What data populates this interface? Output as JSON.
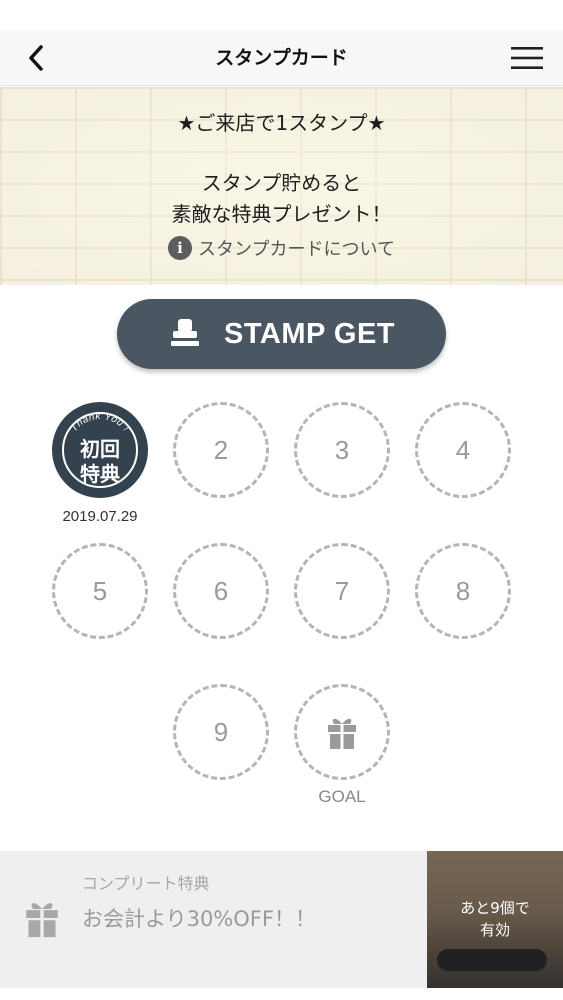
{
  "nav": {
    "title": "スタンプカード"
  },
  "banner": {
    "line1": "★ご来店で1スタンプ★",
    "line2": "スタンプ貯めると",
    "line3": "素敵な特典プレゼント！",
    "info_link": "スタンプカードについて"
  },
  "stamp_button": {
    "label": "STAMP GET",
    "icon": "stamp-icon"
  },
  "stamp_card": {
    "first": {
      "arc_text": "Thank You !",
      "label_line1": "初回",
      "label_line2": "特典",
      "date": "2019.07.29"
    },
    "slots": [
      "2",
      "3",
      "4",
      "5",
      "6",
      "7",
      "8",
      "9"
    ],
    "goal_label": "GOAL",
    "goal_icon": "gift-icon"
  },
  "complete_reward": {
    "title": "コンプリート特典",
    "description": "お会計より30%OFF！！",
    "remaining_line1": "あと9個で",
    "remaining_line2": "有効"
  },
  "colors": {
    "button": "#4a5662",
    "stamp": "#34424f",
    "slot_border": "#b5b5b5"
  }
}
